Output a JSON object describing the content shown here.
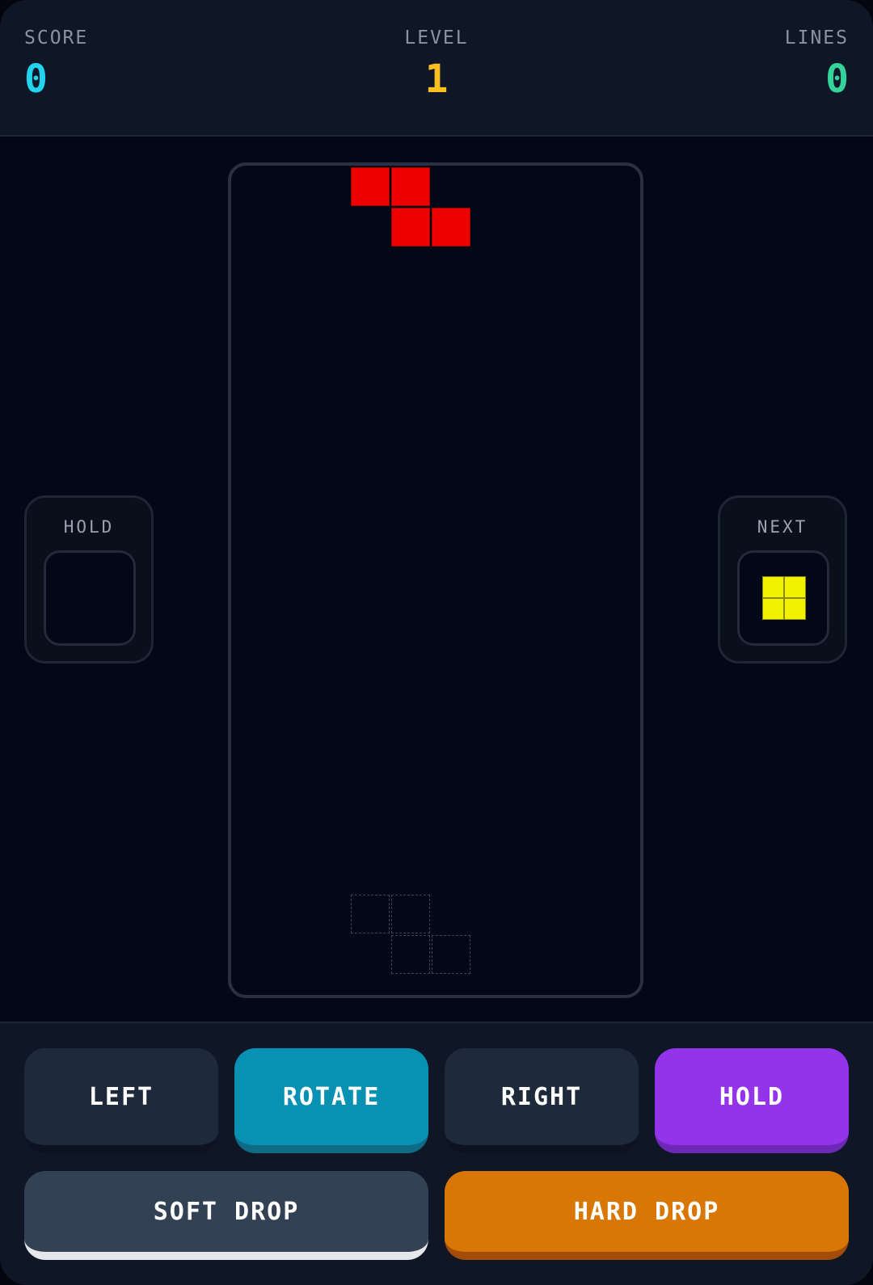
{
  "hud": {
    "score": {
      "label": "SCORE",
      "value": "0",
      "color": "#22d3ee"
    },
    "level": {
      "label": "LEVEL",
      "value": "1",
      "color": "#fbbf24"
    },
    "lines": {
      "label": "LINES",
      "value": "0",
      "color": "#34d399"
    }
  },
  "board": {
    "columns": 10,
    "rows": 20,
    "active_piece": {
      "type": "Z",
      "color": "#ee0000",
      "cells": [
        [
          3,
          0
        ],
        [
          4,
          0
        ],
        [
          4,
          1
        ],
        [
          5,
          1
        ]
      ]
    },
    "ghost_piece": {
      "cells": [
        [
          3,
          18
        ],
        [
          4,
          18
        ],
        [
          4,
          19
        ],
        [
          5,
          19
        ]
      ]
    }
  },
  "hold": {
    "title": "HOLD",
    "piece": null
  },
  "next": {
    "title": "NEXT",
    "piece": "O",
    "color": "#f2f200"
  },
  "controls": {
    "left": "LEFT",
    "rotate": "ROTATE",
    "right": "RIGHT",
    "hold": "HOLD",
    "soft_drop": "SOFT DROP",
    "hard_drop": "HARD DROP"
  }
}
